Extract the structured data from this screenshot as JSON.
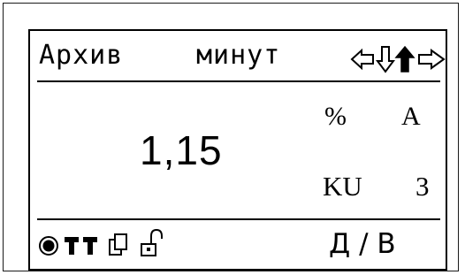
{
  "screen": {
    "title_word1": "Архив",
    "title_word2": "минут",
    "value": "1,15",
    "unit_percent": "%",
    "unit_A": "A",
    "ku_label": "KU",
    "ku_value": "3",
    "mode_label": "Д / В"
  },
  "icons": {
    "nav": [
      "arrow-left-outline-icon",
      "arrow-down-outline-icon",
      "arrow-up-filled-icon",
      "arrow-right-outline-icon"
    ],
    "status": [
      "record-dot-icon",
      "signal-bar-icon",
      "signal-bar-icon",
      "copy-pages-icon",
      "unlocked-padlock-icon"
    ]
  }
}
